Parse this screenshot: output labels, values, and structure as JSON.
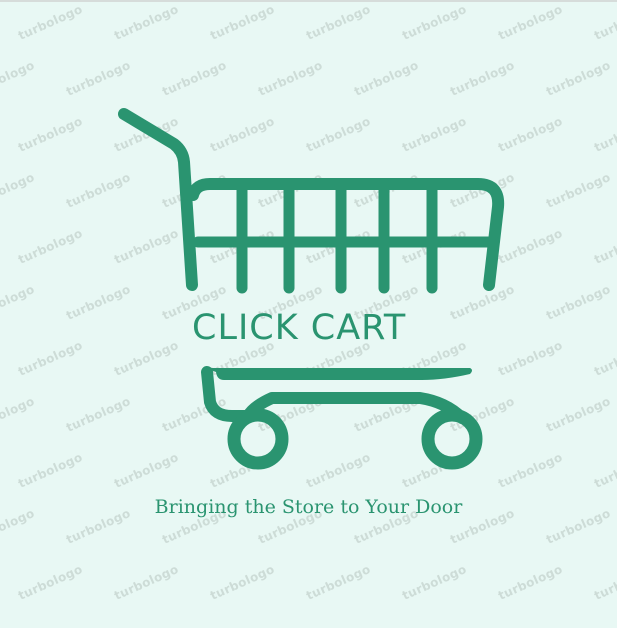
{
  "logo": {
    "brand_name": "CLICK CART",
    "tagline": "Bringing the Store to Your Door",
    "watermark_text": "turbologo",
    "icon": "shopping-cart-icon"
  },
  "colors": {
    "background": "#e8f8f4",
    "brand_green": "#2a9470",
    "watermark": "#c9d8d3"
  }
}
